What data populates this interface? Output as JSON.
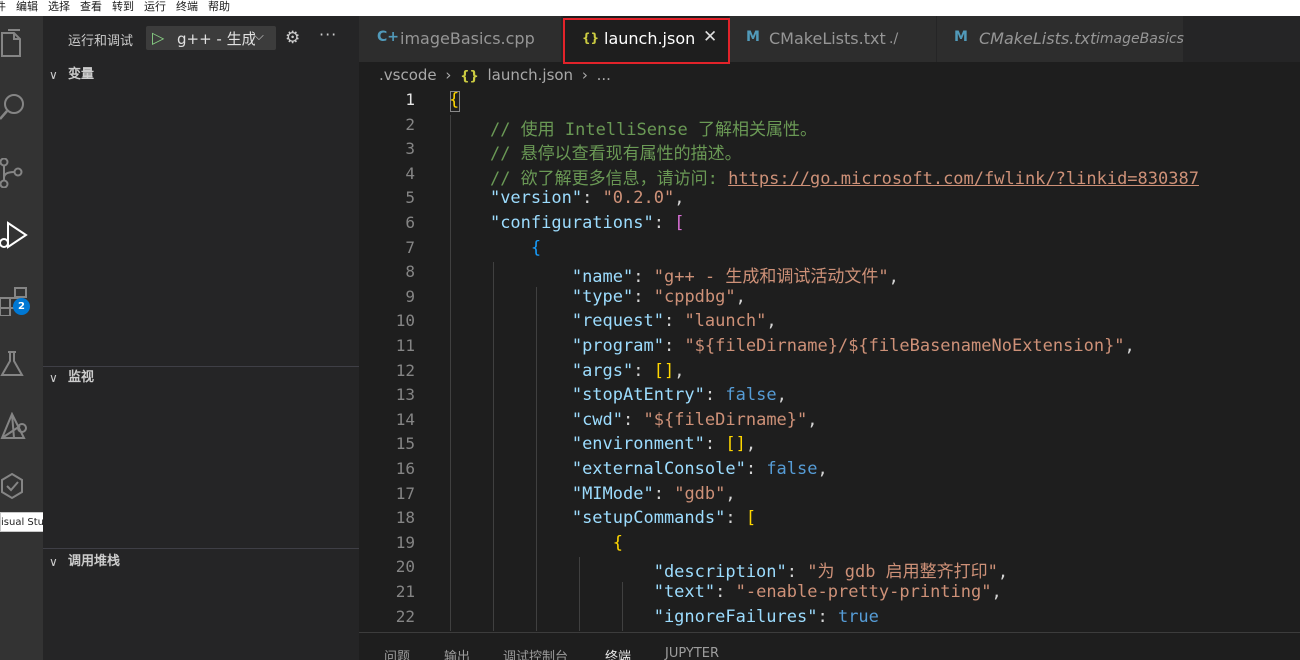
{
  "menu": [
    "件",
    "编辑",
    "选择",
    "查看",
    "转到",
    "运行",
    "终端",
    "帮助"
  ],
  "activity": {
    "extensions_badge": "2",
    "tooltip": "isual Studio Code"
  },
  "sidebar": {
    "title": "运行和调试",
    "run_config": "g++ - 生成和调试活动文件",
    "sections": [
      "变量",
      "监视",
      "调用堆栈"
    ]
  },
  "tabs": [
    {
      "icon": "C+",
      "label": "imageBasics.cpp",
      "desc": ""
    },
    {
      "icon": "{}",
      "label": "launch.json",
      "desc": ""
    },
    {
      "icon": "M",
      "label": "CMakeLists.txt",
      "desc": "./"
    },
    {
      "icon": "M",
      "label": "CMakeLists.txt",
      "desc": "imageBasics"
    }
  ],
  "breadcrumb": {
    "folder": ".vscode",
    "icon": "{}",
    "file": "launch.json",
    "rest": "..."
  },
  "code_lines": [
    {
      "n": "1",
      "t": "{"
    },
    {
      "n": "2",
      "t": "    // 使用 IntelliSense 了解相关属性。"
    },
    {
      "n": "3",
      "t": "    // 悬停以查看现有属性的描述。"
    },
    {
      "n": "4",
      "t": "    // 欲了解更多信息，请访问: https://go.microsoft.com/fwlink/?linkid=830387"
    },
    {
      "n": "5",
      "t": "    \"version\": \"0.2.0\","
    },
    {
      "n": "6",
      "t": "    \"configurations\": ["
    },
    {
      "n": "7",
      "t": "        {"
    },
    {
      "n": "8",
      "t": "            \"name\": \"g++ - 生成和调试活动文件\","
    },
    {
      "n": "9",
      "t": "            \"type\": \"cppdbg\","
    },
    {
      "n": "10",
      "t": "            \"request\": \"launch\","
    },
    {
      "n": "11",
      "t": "            \"program\": \"${fileDirname}/${fileBasenameNoExtension}\","
    },
    {
      "n": "12",
      "t": "            \"args\": [],"
    },
    {
      "n": "13",
      "t": "            \"stopAtEntry\": false,"
    },
    {
      "n": "14",
      "t": "            \"cwd\": \"${fileDirname}\","
    },
    {
      "n": "15",
      "t": "            \"environment\": [],"
    },
    {
      "n": "16",
      "t": "            \"externalConsole\": false,"
    },
    {
      "n": "17",
      "t": "            \"MIMode\": \"gdb\","
    },
    {
      "n": "18",
      "t": "            \"setupCommands\": ["
    },
    {
      "n": "19",
      "t": "                {"
    },
    {
      "n": "20",
      "t": "                    \"description\": \"为 gdb 启用整齐打印\","
    },
    {
      "n": "21",
      "t": "                    \"text\": \"-enable-pretty-printing\","
    },
    {
      "n": "22",
      "t": "                    \"ignoreFailures\": true"
    }
  ],
  "panel_tabs": [
    "问题",
    "输出",
    "调试控制台",
    "终端",
    "JUPYTER"
  ],
  "colors": {
    "highlight_box": "#e2232a",
    "badge": "#0078d4",
    "comment": "#6a9955",
    "string": "#ce9178",
    "property": "#9cdcfe",
    "keyword": "#569cd6"
  }
}
